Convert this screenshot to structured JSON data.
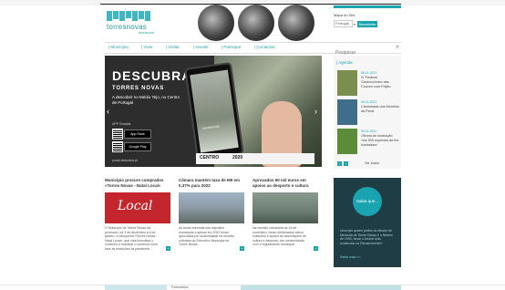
{
  "header": {
    "logo_name": "torresnovas",
    "logo_sub": "município",
    "site_map_label": "Mapa do Site",
    "language_label": "Portugal",
    "subscribe_label": "Newsletter"
  },
  "nav": {
    "items": [
      "| Município",
      "| Viver",
      "| Visitar",
      "| Investir",
      "| Participar",
      "| Contactos"
    ]
  },
  "search": {
    "placeholder": "Pesquisar"
  },
  "hero": {
    "headline": "DESCUBRA",
    "subhead": "TORRES NOVAS",
    "description": "A descobrir no Médio Tejo, no Centro de Portugal",
    "app_label": "APP Gratuita",
    "store_apple": "App Store",
    "store_google": "Google Play",
    "footer_url": "portal.descubra.pt",
    "partner_1": "CENTRO",
    "partner_2": "2020",
    "phone_brand": "torresnovas"
  },
  "agenda": {
    "title": "| Agenda",
    "items": [
      {
        "date": "05.11.2021",
        "text": "IV Festival Gastronómico das Couves com Feijão",
        "color": "#7a8f4e"
      },
      {
        "date": "06.11.2021",
        "text": "Caminhada dos Moinhos da Pena",
        "color": "#3f6e8a"
      },
      {
        "date": "09.11.2021",
        "text": "Oficina de Ilustração «As 500 espécies da flor ilustradas»",
        "color": "#5b8c3a"
      }
    ],
    "see_all": "Ver todos"
  },
  "news": [
    {
      "title": "Município procure comprados «Torres Novas - Natal Local»",
      "body": "O Município de Torres Novas irá promover, de 3 de dezembro a 6 de janeiro, a campanha «Torres Novas - Natal Local», que visa incentivar o consumo e reactivar o comércio local face às restrições da pandemia.",
      "img_color": "#c4262e",
      "img_text": "Local"
    },
    {
      "title": "Câmara mantém taxa de IMI em 0,37% para 2022",
      "body": "As taxas máximas dos impostos municipais a aplicar em 2022 foram aprovadas por unanimidade na reunião ordinária do Executivo Municipal de Torres Novas.",
      "img_color": "#8c9aa6",
      "img_text": ""
    },
    {
      "title": "Aprovados 60 mil euros em apoios ao desporto e cultura",
      "body": "Na reunião camarária de 16 de novembro, foram deliberados vários subsídios e apoios às associações de cultura e desporto, em conformidade com o regulamento municipal.",
      "img_color": "#6d7f75",
      "img_text": ""
    }
  ],
  "sabia": {
    "title": "Sabia que...",
    "text": "Uma das quatro partes do Museu de Memória de Torres Novas é o ficheiro de 1900, tendo o imóvel sido construído no Renascimento?",
    "link": "Saiba mais >>"
  },
  "bottom": {
    "middle_label": "Formulários"
  },
  "colors": {
    "accent": "#1aa4b0",
    "dark_panel": "#1f3d45",
    "hero_bg": "#2d2d2d"
  }
}
